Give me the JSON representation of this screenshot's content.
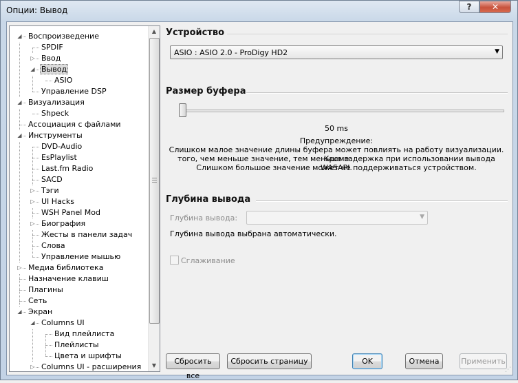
{
  "window": {
    "title": "Опции: Вывод",
    "help": "?",
    "close": "✕"
  },
  "tree": {
    "items": [
      {
        "label": "Воспроизведение",
        "level": 0,
        "expander": "open"
      },
      {
        "label": "SPDIF",
        "level": 1,
        "expander": "none"
      },
      {
        "label": "Ввод",
        "level": 1,
        "expander": "closed"
      },
      {
        "label": "Вывод",
        "level": 1,
        "expander": "open",
        "selected": true
      },
      {
        "label": "ASIO",
        "level": 2,
        "expander": "none"
      },
      {
        "label": "Управление DSP",
        "level": 1,
        "expander": "none"
      },
      {
        "label": "Визуализация",
        "level": 0,
        "expander": "open"
      },
      {
        "label": "Shpeck",
        "level": 1,
        "expander": "none"
      },
      {
        "label": "Ассоциация с файлами",
        "level": 0,
        "expander": "none"
      },
      {
        "label": "Инструменты",
        "level": 0,
        "expander": "open"
      },
      {
        "label": "DVD-Audio",
        "level": 1,
        "expander": "none"
      },
      {
        "label": "EsPlaylist",
        "level": 1,
        "expander": "none"
      },
      {
        "label": "Last.fm Radio",
        "level": 1,
        "expander": "none"
      },
      {
        "label": "SACD",
        "level": 1,
        "expander": "none"
      },
      {
        "label": "Тэги",
        "level": 1,
        "expander": "closed"
      },
      {
        "label": "UI Hacks",
        "level": 1,
        "expander": "closed"
      },
      {
        "label": "WSH Panel Mod",
        "level": 1,
        "expander": "none"
      },
      {
        "label": "Биография",
        "level": 1,
        "expander": "closed"
      },
      {
        "label": "Жесты в панели задач",
        "level": 1,
        "expander": "none"
      },
      {
        "label": "Слова",
        "level": 1,
        "expander": "none"
      },
      {
        "label": "Управление мышью",
        "level": 1,
        "expander": "none"
      },
      {
        "label": "Медиа библиотека",
        "level": 0,
        "expander": "closed"
      },
      {
        "label": "Назначение клавиш",
        "level": 0,
        "expander": "none"
      },
      {
        "label": "Плагины",
        "level": 0,
        "expander": "none"
      },
      {
        "label": "Сеть",
        "level": 0,
        "expander": "none"
      },
      {
        "label": "Экран",
        "level": 0,
        "expander": "open"
      },
      {
        "label": "Columns UI",
        "level": 1,
        "expander": "open"
      },
      {
        "label": "Вид плейлиста",
        "level": 2,
        "expander": "none"
      },
      {
        "label": "Плейлисты",
        "level": 2,
        "expander": "none"
      },
      {
        "label": "Цвета и шрифты",
        "level": 2,
        "expander": "none"
      },
      {
        "label": "Columns UI - расширения",
        "level": 1,
        "expander": "closed"
      }
    ]
  },
  "device": {
    "heading": "Устройство",
    "selected": "ASIO : ASIO 2.0 - ProDigy HD2"
  },
  "buffer": {
    "heading": "Размер буфера",
    "slider_fraction": 0.0,
    "value_text": "50 ms",
    "warning_title": "Предупреждение:",
    "warning_lines": [
      "Слишком малое значение длины буфера может повлиять на работу визуализации. Кроме",
      "того, чем меньше значение, тем меньше задержка при использовании вывода WASAPI.",
      "Слишком большое значение может не поддерживаться устройством."
    ]
  },
  "depth": {
    "heading": "Глубина вывода",
    "field_label": "Глубина вывода:",
    "field_value": "",
    "info": "Глубина вывода выбрана автоматически.",
    "dither_label": "Сглаживание"
  },
  "buttons": {
    "reset_all": "Сбросить все",
    "reset_page": "Сбросить страницу",
    "ok": "OK",
    "cancel": "Отмена",
    "apply": "Применить"
  }
}
